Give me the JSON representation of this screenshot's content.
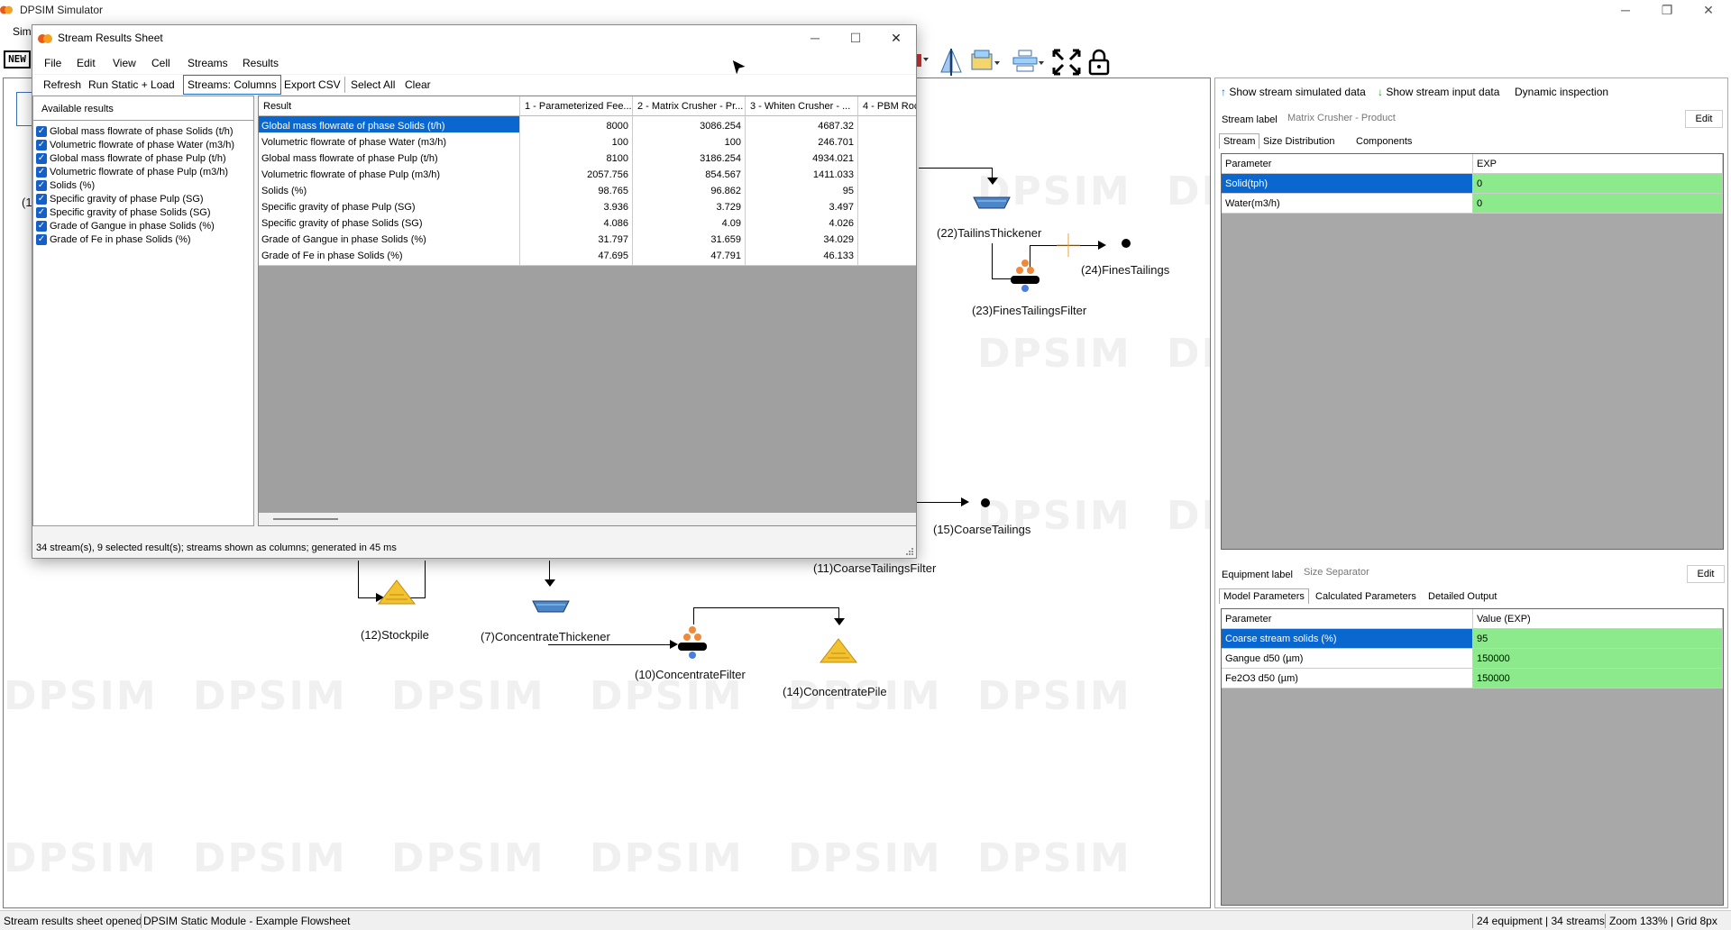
{
  "app": {
    "title": "DPSIM Simulator",
    "menu_partial": "Sim"
  },
  "dialog": {
    "title": "Stream Results Sheet",
    "menu": [
      "File",
      "Edit",
      "View",
      "Cell",
      "Streams",
      "Results"
    ],
    "toolbar": {
      "refresh": "Refresh",
      "run": "Run Static + Load",
      "streams_mode": "Streams: Columns",
      "export": "Export CSV",
      "select_all": "Select All",
      "clear": "Clear"
    },
    "available_title": "Available results",
    "available_results": [
      "Global mass flowrate of phase Solids (t/h)",
      "Volumetric flowrate of phase Water (m3/h)",
      "Global mass flowrate of phase Pulp (t/h)",
      "Volumetric flowrate of phase Pulp (m3/h)",
      "Solids (%)",
      "Specific gravity of phase Pulp (SG)",
      "Specific gravity of phase Solids (SG)",
      "Grade of Gangue in phase Solids (%)",
      "Grade of Fe in phase Solids (%)"
    ],
    "table": {
      "headers": [
        "Result",
        "1 - Parameterized Fee...",
        "2 - Matrix Crusher - Pr...",
        "3 - Whiten Crusher - ...",
        "4 - PBM Roc"
      ],
      "rows": [
        [
          "Global mass flowrate of phase Solids (t/h)",
          "8000",
          "3086.254",
          "4687.32",
          ""
        ],
        [
          "Volumetric flowrate of phase Water (m3/h)",
          "100",
          "100",
          "246.701",
          ""
        ],
        [
          "Global mass flowrate of phase Pulp (t/h)",
          "8100",
          "3186.254",
          "4934.021",
          ""
        ],
        [
          "Volumetric flowrate of phase Pulp (m3/h)",
          "2057.756",
          "854.567",
          "1411.033",
          ""
        ],
        [
          "Solids (%)",
          "98.765",
          "96.862",
          "95",
          ""
        ],
        [
          "Specific gravity of phase Pulp (SG)",
          "3.936",
          "3.729",
          "3.497",
          ""
        ],
        [
          "Specific gravity of phase Solids (SG)",
          "4.086",
          "4.09",
          "4.026",
          ""
        ],
        [
          "Grade of Gangue in phase Solids (%)",
          "31.797",
          "31.659",
          "34.029",
          ""
        ],
        [
          "Grade of Fe in phase Solids (%)",
          "47.695",
          "47.791",
          "46.133",
          ""
        ]
      ]
    },
    "status": "34 stream(s), 9 selected result(s); streams shown as columns; generated in 45 ms"
  },
  "canvas": {
    "watermark": "DPSIM",
    "nodes": {
      "tailings_thickener": "(22)TailinsThickener",
      "fines_tailings": "(24)FinesTailings",
      "fines_tailings_filter": "(23)FinesTailingsFilter",
      "coarse_tailings": "(15)CoarseTailings",
      "coarse_tailings_filter": "(11)CoarseTailingsFilter",
      "stockpile": "(12)Stockpile",
      "concentrate_thickener": "(7)ConcentrateThickener",
      "concentrate_filter": "(10)ConcentrateFilter",
      "concentrate_pile": "(14)ConcentratePile",
      "partial_left": "(1"
    }
  },
  "right_panel": {
    "show_simulated": "Show stream simulated data",
    "show_input": "Show stream input data",
    "dynamic": "Dynamic inspection",
    "stream_label": "Stream label",
    "stream_value": "Matrix Crusher - Product",
    "edit": "Edit",
    "stream_tabs": [
      "Stream",
      "Size Distribution",
      "Components"
    ],
    "stream_grid": {
      "headers": [
        "Parameter",
        "EXP"
      ],
      "rows": [
        [
          "Solid(tph)",
          "0"
        ],
        [
          "Water(m3/h)",
          "0"
        ]
      ]
    },
    "equipment_label": "Equipment label",
    "equipment_value": "Size Separator",
    "equipment_tabs": [
      "Model Parameters",
      "Calculated Parameters",
      "Detailed Output"
    ],
    "equipment_grid": {
      "headers": [
        "Parameter",
        "Value (EXP)"
      ],
      "rows": [
        [
          "Coarse stream solids (%)",
          "95"
        ],
        [
          "Gangue d50 (µm)",
          "150000"
        ],
        [
          "Fe2O3 d50 (µm)",
          "150000"
        ]
      ]
    }
  },
  "status_bar": {
    "message": "Stream results sheet opened",
    "module": "DPSIM Static Module - Example Flowsheet",
    "counts": "24 equipment | 34 streams",
    "zoom": "Zoom 133% | Grid 8px"
  },
  "colors": {
    "selection": "#0a67d0",
    "value_green": "#8cea8c",
    "grid_bg": "#a0a0a0",
    "pile_yellow": "#f2c230",
    "thickener_blue": "#4a86c8"
  }
}
